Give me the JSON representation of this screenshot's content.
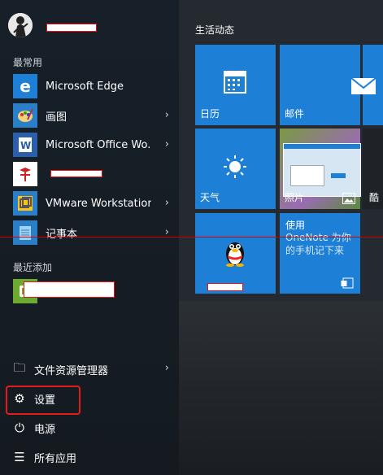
{
  "user": {
    "name": ""
  },
  "sections": {
    "most_used": "最常用",
    "recently_added": "最近添加"
  },
  "apps": [
    {
      "label": "Microsoft Edge",
      "icon": "edge-icon",
      "color": "#1e7fd6",
      "has_submenu": false
    },
    {
      "label": "画图",
      "icon": "paint-icon",
      "color": "#2a80c8",
      "has_submenu": true
    },
    {
      "label": "Microsoft Office Wo...",
      "icon": "word-icon",
      "color": "#2b5fad",
      "has_submenu": true
    },
    {
      "label": "",
      "icon": "app-icon",
      "color": "#ffffff",
      "has_submenu": false
    },
    {
      "label": "VMware Workstation",
      "icon": "vmware-icon",
      "color": "#2a80c8",
      "has_submenu": true
    },
    {
      "label": "记事本",
      "icon": "notepad-icon",
      "color": "#2a80c8",
      "has_submenu": true
    }
  ],
  "recent_app": {
    "label": "",
    "icon": "recent-app-icon",
    "color": "#6cab2e"
  },
  "system_items": [
    {
      "label": "文件资源管理器",
      "icon": "folder-icon",
      "glyph": "🗀",
      "has_submenu": true
    },
    {
      "label": "设置",
      "icon": "gear-icon",
      "glyph": "⚙",
      "has_submenu": false
    },
    {
      "label": "电源",
      "icon": "power-icon",
      "glyph": "⏻",
      "has_submenu": false
    },
    {
      "label": "所有应用",
      "icon": "all-apps-icon",
      "glyph": "☰",
      "has_submenu": false
    }
  ],
  "tiles": {
    "group_title": "生活动态",
    "calendar": "日历",
    "mail": "邮件",
    "weather": "天气",
    "photos": "照片",
    "partial": "酷",
    "qq": "",
    "onenote_title": "使用",
    "onenote_text": "OneNote 为你的手机记下来"
  }
}
